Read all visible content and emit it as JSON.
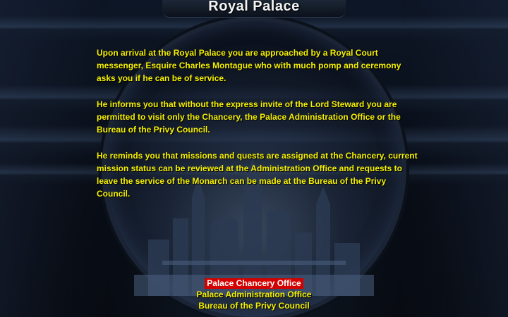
{
  "title": "Royal Palace",
  "colors": {
    "text": "#f5f000",
    "title": "#f2f2f2",
    "selected_bg": "#d40000",
    "selected_text": "#ffffff",
    "background": "#070b13"
  },
  "narrative": {
    "paragraphs": [
      "Upon arrival at the Royal Palace you are approached by a Royal Court messenger, Esquire Charles Montague who with much pomp and ceremony asks you if he can be of service.",
      "He informs you that without the express invite of the Lord Steward you are permitted to visit only the Chancery, the Palace Administration Office or the Bureau of the Privy Council.",
      "He reminds you that missions and quests are assigned at the Chancery, current mission status can be reviewed at the Administration Office and requests to leave the service of the Monarch can be made at the Bureau of the Privy Council."
    ]
  },
  "menu": {
    "selected_index": 0,
    "items": [
      "Palace Chancery Office",
      "Palace Administration Office",
      "Bureau of the Privy Council"
    ]
  }
}
